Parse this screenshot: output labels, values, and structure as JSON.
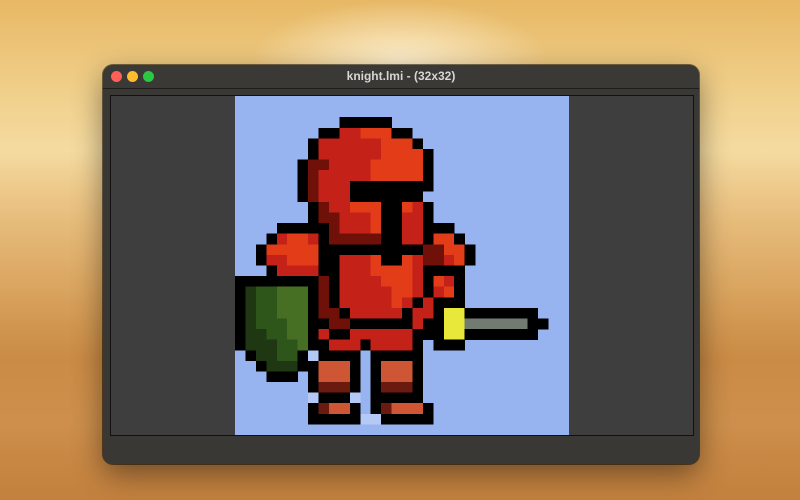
{
  "window": {
    "title": "knight.lmi - (32x32)",
    "controls": [
      "close",
      "minimize",
      "zoom"
    ]
  },
  "canvas": {
    "columns": 32,
    "rows": 32,
    "palette": {
      ".": "#97b4f0",
      "K": "#000000",
      "R": "#c42118",
      "O": "#e23c19",
      "D": "#701109",
      "a": "#1f3713",
      "b": "#2e561a",
      "c": "#476f23",
      "Y": "#e8e83a",
      "S": "#717b70",
      "B": "#cf5634",
      "b2": "#6b1a10",
      "L": "#b4c9f5"
    },
    "pixels": [
      "................................",
      "................................",
      "..........KKKKK.................",
      "........KKRROOOKK...............",
      ".......KRRRRRROOOK..............",
      ".......KRRRRRROOOOK.............",
      "......KDDRRRROOOOOK.............",
      "......KDRRRRROOOOOK.............",
      "......KDRRRKKKKKKKK.............",
      "......KDRRRKKKKKKK..............",
      ".......KDRROOOKKORK.............",
      ".......KDDRRROKKRRK.............",
      "....KKKKKDRRROKKRRKKK...........",
      "...KROORKDDDDDKKRRKOOK..........",
      "..KOOOOOKKKKKKKKKKDDOOK.........",
      "..KRROOOKKRRROKKORDDROK.........",
      "...KRRRRKKRRROOOORKKKK..........",
      "KKKKKKKKDKRRRROOORKORK..........",
      "KabbcccKDKRRRRROORKROK..........",
      "KabbcccKDKRRRRRORKRKKK..........",
      "KabbcccKDDKRRRRRKRRKYYKKKKKKK...",
      "KabbbccKKDDKKKKKKRKKYYSSSSSSKK..",
      "KaabbccKRKKRRRRRRKKKYYKKKKKKK...",
      "KaaabbcKKRRRKRRRRK.KKK..........",
      ".KaabbKLKKKK.KKKKK..............",
      "..KaaaKKBBBK.KBBBK..............",
      "...KKK.KBBBK.KBBBK..............",
      ".......KxxxK.KxxxK..............",
      ".......LKKKL.KKKKK..............",
      ".......KxBBK.KxBBBK.............",
      ".......KKKKKLLKKKKK.............",
      "................................"
    ]
  }
}
